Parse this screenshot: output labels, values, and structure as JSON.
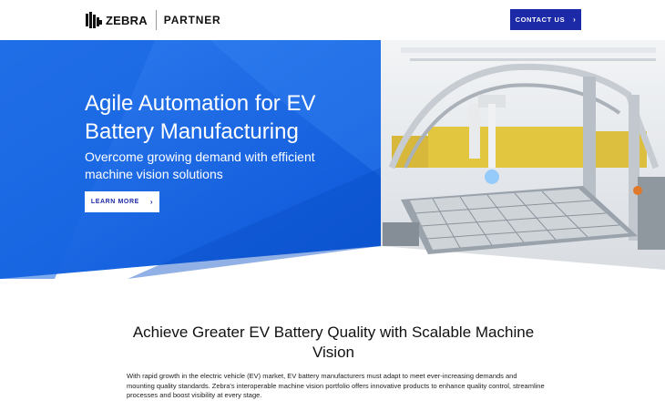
{
  "header": {
    "brand": "ZEBRA",
    "partner": "PARTNER",
    "contact_label": "CONTACT US",
    "chevron": "›"
  },
  "hero": {
    "title": "Agile Automation for EV Battery Manufacturing",
    "subtitle": "Overcome growing demand with efficient machine vision solutions",
    "cta_label": "LEARN MORE",
    "chevron": "›",
    "image_icon": "ev-battery-assembly-photo"
  },
  "section": {
    "title": "Achieve Greater EV Battery Quality with Scalable Machine Vision",
    "body": "With rapid growth in the electric vehicle (EV) market, EV battery manufacturers must adapt to meet ever-increasing demands and mounting quality standards. Zebra's interoperable machine vision portfolio offers innovative products to enhance quality control, streamline processes and boost visibility at every stage."
  },
  "colors": {
    "brand_blue": "#1d2aa7",
    "hero_blue": "#1f6fe8",
    "hero_blue_dark": "#0d54cf"
  }
}
